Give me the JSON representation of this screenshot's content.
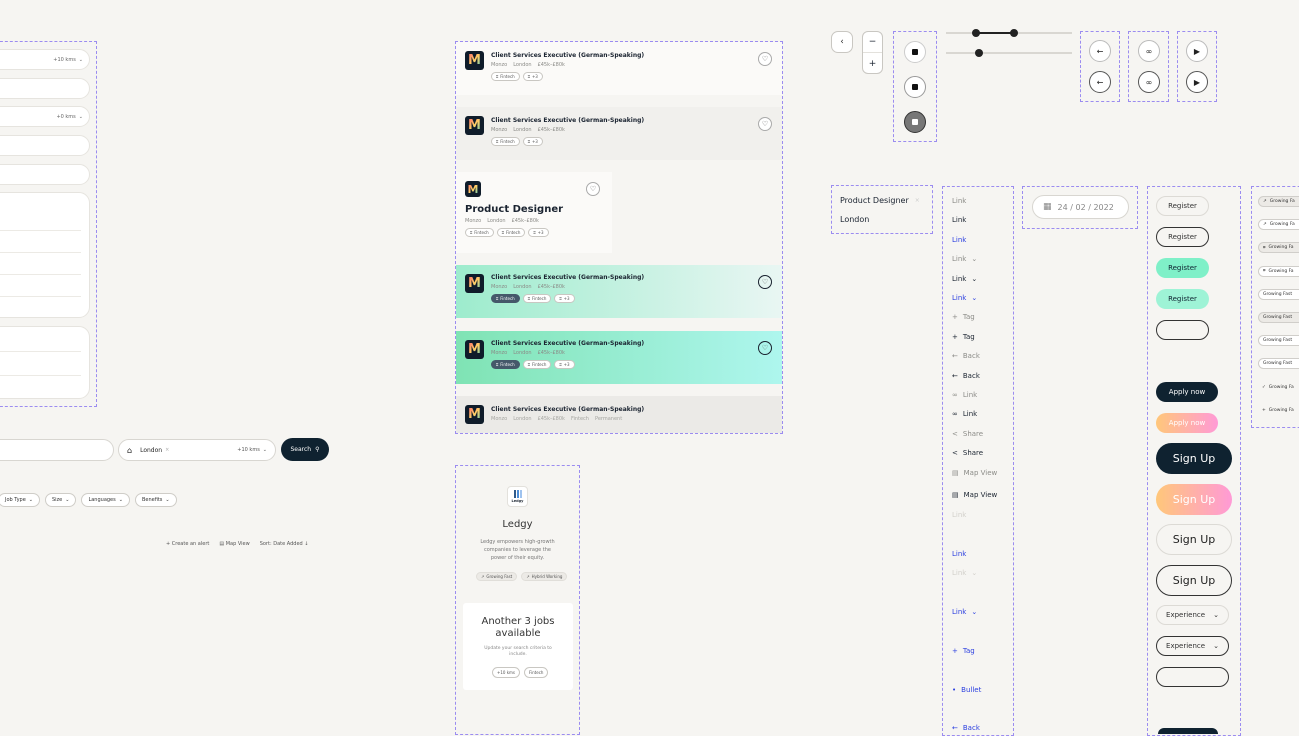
{
  "form_panel": {
    "distance1": "+10 kms",
    "distance2": "+0 kms"
  },
  "search_bar": {
    "location": "London",
    "distance": "+10 kms",
    "button": "Search"
  },
  "filters": [
    "Job Type",
    "Size",
    "Languages",
    "Benefits"
  ],
  "toolbar": {
    "alert": "Create an alert",
    "map": "Map View",
    "sort": "Sort:  Date Added"
  },
  "job_cards": [
    {
      "title": "Client Services Executive (German-Speaking)",
      "company": "Monzo",
      "location": "London",
      "salary": "£45k–£80k",
      "tags": [
        "Fintech",
        "+3"
      ]
    },
    {
      "title": "Client Services Executive (German-Speaking)",
      "company": "Monzo",
      "location": "London",
      "salary": "£45k–£80k",
      "tags": [
        "Fintech",
        "+3"
      ]
    },
    {
      "title": "Product Designer",
      "company": "Monzo",
      "location": "London",
      "salary": "£45k–£80k",
      "tags": [
        "Fintech",
        "Fintech",
        "+3"
      ]
    },
    {
      "title": "Client Services Executive (German-Speaking)",
      "company": "Monzo",
      "location": "London",
      "salary": "£45k–£80k",
      "tags": [
        "Fintech",
        "Fintech",
        "+3"
      ]
    },
    {
      "title": "Client Services Executive (German-Speaking)",
      "company": "Monzo",
      "location": "London",
      "salary": "£45k–£80k",
      "tags": [
        "Fintech",
        "Fintech",
        "+3"
      ]
    },
    {
      "title": "Client Services Executive (German-Speaking)",
      "company": "Monzo",
      "location": "London",
      "salary": "£45k–£80k",
      "extra1": "Fintech",
      "extra2": "Permanent"
    }
  ],
  "company_card": {
    "logo_text": "Ledgy",
    "name": "Ledgy",
    "description": "Ledgy empowers high-growth companies to leverage the power of their equity.",
    "tags": [
      "Growing Fast",
      "Hybrid Working"
    ],
    "more_title": "Another 3 jobs available",
    "more_desc": "Update your search criteria to include.",
    "more_tags": [
      "+10 kms",
      "Fintech"
    ]
  },
  "controls": {
    "back": "‹",
    "minus": "−",
    "plus": "+"
  },
  "dropdown_list": {
    "items": [
      "Product Designer",
      "London"
    ]
  },
  "links": [
    {
      "label": "Link",
      "style": "muted"
    },
    {
      "label": "Link",
      "style": "dark"
    },
    {
      "label": "Link",
      "style": "blue"
    },
    {
      "label": "Link",
      "style": "muted",
      "chev": true
    },
    {
      "label": "Link",
      "style": "dark",
      "chev": true
    },
    {
      "label": "Link",
      "style": "blue",
      "chev": true
    },
    {
      "label": "Tag",
      "style": "muted",
      "icon": "+"
    },
    {
      "label": "Tag",
      "style": "dark",
      "icon": "+"
    },
    {
      "label": "Back",
      "style": "muted",
      "icon": "←"
    },
    {
      "label": "Back",
      "style": "dark",
      "icon": "←"
    },
    {
      "label": "Link",
      "style": "muted",
      "icon": "∞"
    },
    {
      "label": "Link",
      "style": "dark",
      "icon": "∞"
    },
    {
      "label": "Share",
      "style": "muted",
      "icon": "<"
    },
    {
      "label": "Share",
      "style": "dark",
      "icon": "<"
    },
    {
      "label": "Map View",
      "style": "muted",
      "icon": "▤"
    },
    {
      "label": "Map View",
      "style": "dark",
      "icon": "▤"
    }
  ],
  "links_lower": {
    "faded1": "Link",
    "blue1": "Link",
    "faded2": "Link",
    "blue2": "Link",
    "tag": "Tag",
    "bullet": "Bullet",
    "back": "Back"
  },
  "date_input": {
    "value": "24 / 02 / 2022"
  },
  "buttons": {
    "register": "Register",
    "apply": "Apply now",
    "signup": "Sign Up",
    "experience": "Experience"
  },
  "tags_column": [
    "Growing Fa",
    "Growing Fa",
    "Growing Fa",
    "Growing Fa",
    "Growing Fast",
    "Growing Fast",
    "Growing Fast",
    "Growing Fast",
    "Growing Fa",
    "Growing Fa"
  ],
  "colors": {
    "dark": "#0f2230",
    "mint": "#7ff0c8",
    "accent": "#9b8cf0",
    "link_blue": "#2b3fe0"
  }
}
